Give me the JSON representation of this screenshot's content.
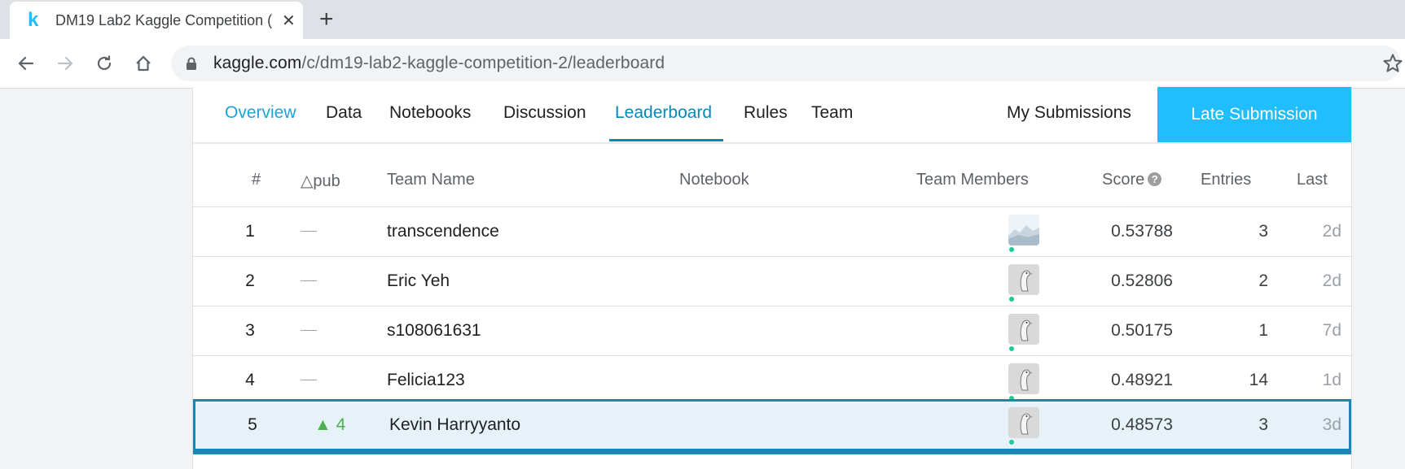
{
  "browser": {
    "tab_title": "DM19 Lab2 Kaggle Competition (",
    "favicon": "k",
    "close_glyph": "✕",
    "new_tab_glyph": "+",
    "url_host": "kaggle.com",
    "url_path": "/c/dm19-lab2-kaggle-competition-2/leaderboard"
  },
  "nav": {
    "overview": "Overview",
    "data": "Data",
    "notebooks": "Notebooks",
    "discussion": "Discussion",
    "leaderboard": "Leaderboard",
    "rules": "Rules",
    "team": "Team",
    "my_submissions": "My Submissions",
    "late_submission": "Late Submission"
  },
  "leaderboard": {
    "headers": {
      "rank": "#",
      "delta": "△pub",
      "team_name": "Team Name",
      "notebook": "Notebook",
      "team_members": "Team Members",
      "score": "Score",
      "entries": "Entries",
      "last": "Last"
    },
    "rows": [
      {
        "rank": "1",
        "delta": "",
        "team": "transcendence",
        "score": "0.53788",
        "entries": "3",
        "last": "2d",
        "avatar": "landscape-avatar"
      },
      {
        "rank": "2",
        "delta": "",
        "team": "Eric Yeh",
        "score": "0.52806",
        "entries": "2",
        "last": "2d",
        "avatar": "goose-avatar"
      },
      {
        "rank": "3",
        "delta": "",
        "team": "s108061631",
        "score": "0.50175",
        "entries": "1",
        "last": "7d",
        "avatar": "goose-avatar"
      },
      {
        "rank": "4",
        "delta": "",
        "team": "Felicia123",
        "score": "0.48921",
        "entries": "14",
        "last": "1d",
        "avatar": "goose-avatar"
      },
      {
        "rank": "5",
        "delta": "▲ 4",
        "team": "Kevin Harryyanto",
        "score": "0.48573",
        "entries": "3",
        "last": "3d",
        "avatar": "goose-avatar",
        "highlighted": true
      }
    ]
  },
  "colors": {
    "accent": "#20beff",
    "active_tab": "#008abc",
    "highlight_border": "#1a86b6",
    "highlight_bg": "#e6f2f8",
    "rank_up": "#4caf50",
    "online_dot": "#20c997"
  }
}
